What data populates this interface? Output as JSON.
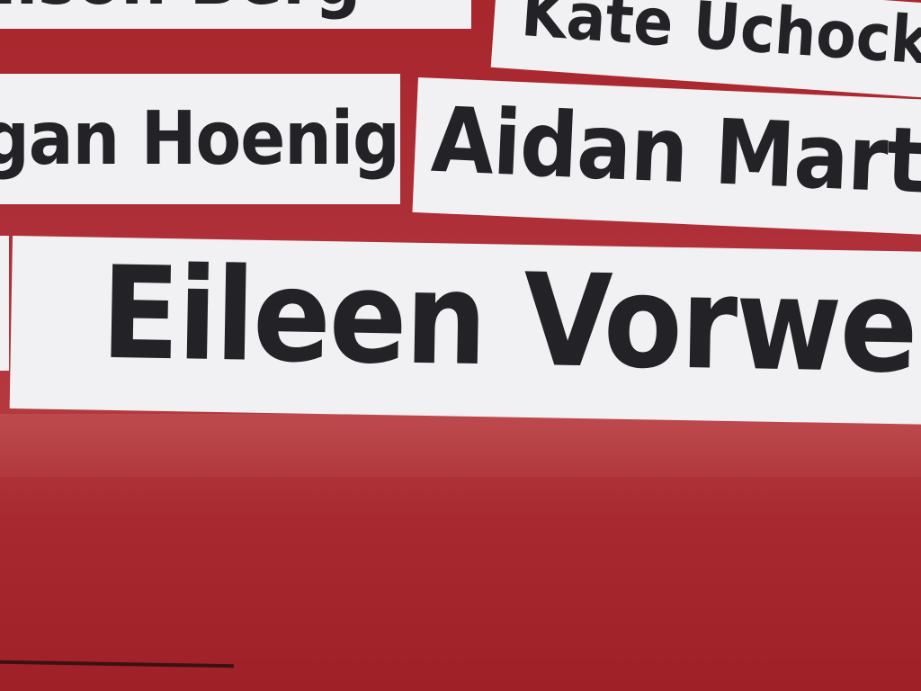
{
  "labels": [
    {
      "text": "…son Berg"
    },
    {
      "text": "Kate Uchock"
    },
    {
      "text": "gan Hoenig"
    },
    {
      "text": "Aidan Martin"
    },
    {
      "text": "Eileen Vorwerk"
    }
  ],
  "colors": {
    "surface": "#a8262c",
    "label": "#f1f0f2",
    "ink": "#232226"
  }
}
